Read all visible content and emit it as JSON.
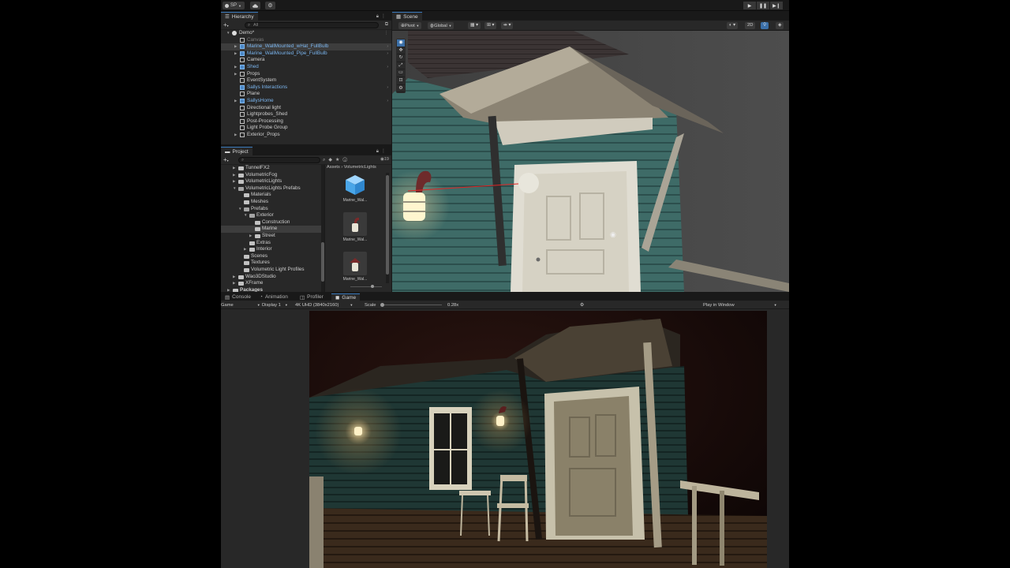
{
  "toolbar": {
    "account_label": "SP",
    "cloud_icon": "cloud-icon",
    "settings_icon": "gear-icon",
    "play": "play-icon",
    "pause": "pause-icon",
    "step": "step-icon"
  },
  "hierarchy": {
    "tab_label": "Hierarchy",
    "search_placeholder": "All",
    "add_label": "+",
    "rows": [
      {
        "label": "Demo*",
        "depth": 0,
        "kind": "scene",
        "arrow": "▼"
      },
      {
        "label": "Canvas",
        "depth": 1,
        "kind": "dim"
      },
      {
        "label": "Marine_WallMounted_wHat_FullBulb",
        "depth": 1,
        "kind": "prefab",
        "arrow": "▶",
        "selected": true
      },
      {
        "label": "Marine_WallMounted_Pipe_FullBulb",
        "depth": 1,
        "kind": "prefab",
        "arrow": "▶"
      },
      {
        "label": "Camera",
        "depth": 1,
        "kind": "object"
      },
      {
        "label": "Shed",
        "depth": 1,
        "kind": "prefab",
        "arrow": "▶"
      },
      {
        "label": "Props",
        "depth": 1,
        "kind": "object",
        "arrow": "▶"
      },
      {
        "label": "EventSystem",
        "depth": 1,
        "kind": "object"
      },
      {
        "label": "Sallys Interactions",
        "depth": 1,
        "kind": "prefab"
      },
      {
        "label": "Plane",
        "depth": 1,
        "kind": "object"
      },
      {
        "label": "SallysHome",
        "depth": 1,
        "kind": "prefab",
        "arrow": "▶"
      },
      {
        "label": "Directional light",
        "depth": 1,
        "kind": "object"
      },
      {
        "label": "Lightprobes_Shed",
        "depth": 1,
        "kind": "object"
      },
      {
        "label": "Post-Processing",
        "depth": 1,
        "kind": "object"
      },
      {
        "label": "Light Probe Group",
        "depth": 1,
        "kind": "object"
      },
      {
        "label": "Exterior_Props",
        "depth": 1,
        "kind": "object",
        "arrow": "▶"
      }
    ]
  },
  "project": {
    "tab_label": "Project",
    "add_label": "+",
    "count_label": "19",
    "breadcrumb": "Assets › VolumetricLights",
    "tree": [
      {
        "label": "TunnelFX2",
        "depth": 1,
        "arrow": "▶"
      },
      {
        "label": "VolumetricFog",
        "depth": 1,
        "arrow": "▶"
      },
      {
        "label": "VolumetricLights",
        "depth": 1,
        "arrow": "▶"
      },
      {
        "label": "VolumetricLights Prefabs",
        "depth": 1,
        "arrow": "▼",
        "open": true
      },
      {
        "label": "Materials",
        "depth": 2
      },
      {
        "label": "Meshes",
        "depth": 2
      },
      {
        "label": "Prefabs",
        "depth": 2,
        "arrow": "▼",
        "open": true
      },
      {
        "label": "Exterior",
        "depth": 3,
        "arrow": "▼",
        "open": true
      },
      {
        "label": "Construction",
        "depth": 4
      },
      {
        "label": "Marine",
        "depth": 4,
        "selected": true
      },
      {
        "label": "Street",
        "depth": 4,
        "arrow": "▶"
      },
      {
        "label": "Extras",
        "depth": 3
      },
      {
        "label": "Interior",
        "depth": 3,
        "arrow": "▶"
      },
      {
        "label": "Scenes",
        "depth": 2
      },
      {
        "label": "Textures",
        "depth": 2
      },
      {
        "label": "Volumetric Light Profiles",
        "depth": 2
      },
      {
        "label": "Wao3DStudio",
        "depth": 1,
        "arrow": "▶"
      },
      {
        "label": "XFrame",
        "depth": 1,
        "arrow": "▶"
      },
      {
        "label": "Packages",
        "depth": 0,
        "arrow": "▶",
        "bold": true
      }
    ],
    "assets": [
      {
        "name": "Marine_Wal...",
        "kind": "cube"
      },
      {
        "name": "Marine_Wal...",
        "kind": "lamp-pipe"
      },
      {
        "name": "Marine_Wal...",
        "kind": "lamp-hat"
      }
    ]
  },
  "scene": {
    "tab_label": "Scene",
    "pivot_label": "Pivot",
    "global_label": "Global",
    "mode_2d": "2D",
    "tools": [
      "view-tool-icon",
      "move-tool-icon",
      "rotate-tool-icon",
      "scale-tool-icon",
      "rect-tool-icon",
      "transform-tool-icon",
      "custom-tool-icon"
    ]
  },
  "bottom_tabs": [
    {
      "label": "Console",
      "icon": "console-icon"
    },
    {
      "label": "Animation",
      "icon": "animation-icon"
    },
    {
      "label": "Profiler",
      "icon": "profiler-icon"
    },
    {
      "label": "Game",
      "icon": "game-icon",
      "active": true
    }
  ],
  "game": {
    "mode_label": "Game",
    "display_label": "Display 1",
    "resolution_label": "4K UHD (3840x2160)",
    "scale_label": "Scale",
    "scale_value": "0.28x",
    "scale_fraction": 0.0,
    "play_mode_label": "Play in Window"
  },
  "colors": {
    "accent": "#3b6fa7",
    "prefab_text": "#7bb5ee",
    "panel_bg": "#282828",
    "header_bg": "#191919"
  }
}
